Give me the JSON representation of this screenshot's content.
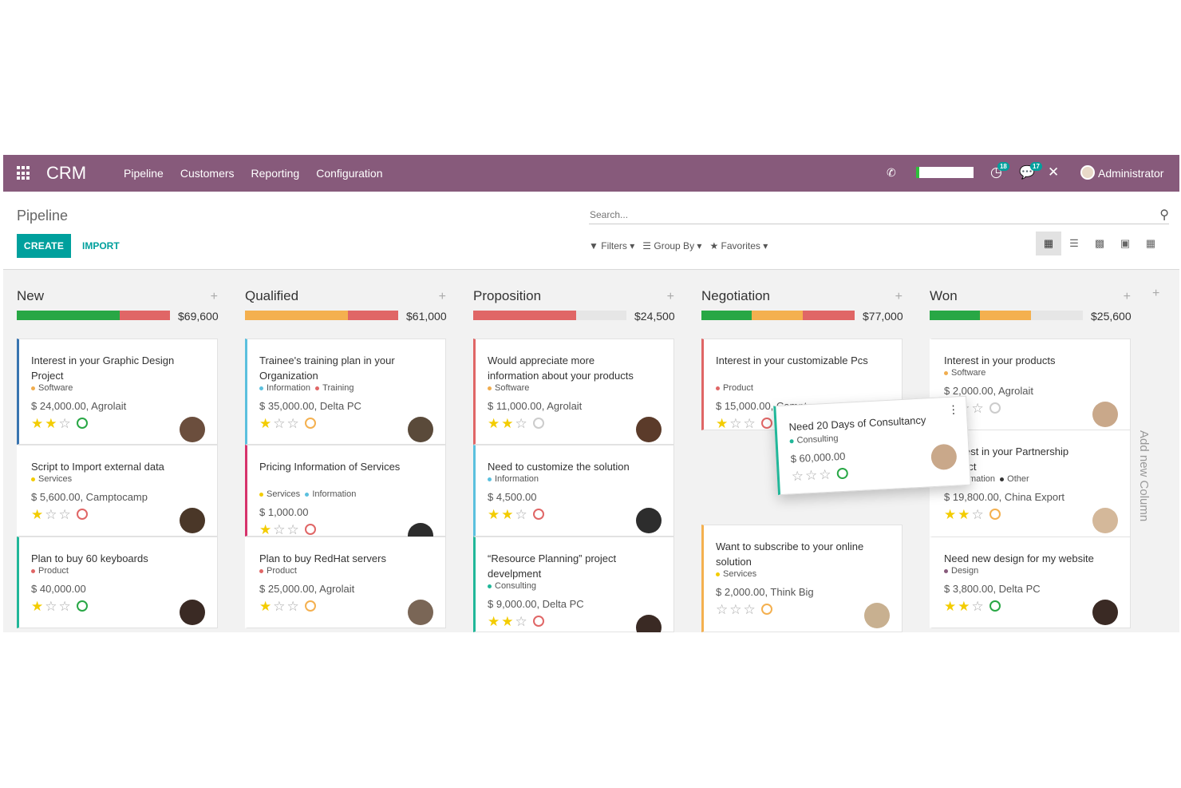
{
  "navbar": {
    "brand": "CRM",
    "menu": [
      "Pipeline",
      "Customers",
      "Reporting",
      "Configuration"
    ],
    "activity_count": "18",
    "message_count": "17",
    "user": "Administrator"
  },
  "control": {
    "breadcrumb": "Pipeline",
    "create_label": "CREATE",
    "import_label": "IMPORT",
    "search_placeholder": "Search...",
    "filters_label": "Filters",
    "group_by_label": "Group By",
    "favorites_label": "Favorites"
  },
  "columns": [
    {
      "title": "New",
      "total": "$69,600",
      "progress": [
        {
          "color": "#28a745",
          "pct": 0.67
        },
        {
          "color": "#e06666",
          "pct": 0.33
        }
      ],
      "cards": [
        {
          "title": "Interest in your Graphic Design Project",
          "tags": [
            {
              "label": "Software",
              "color": "#f0ad4e"
            }
          ],
          "amount": "$ 24,000.00, Agrolait",
          "stars": 2,
          "clock": "#28a745",
          "border": "#3874b0",
          "avatar": "#6b4e3d"
        },
        {
          "title": "Script to Import external data",
          "tags": [
            {
              "label": "Services",
              "color": "#f3cc00"
            }
          ],
          "amount": "$ 5,600.00, Camptocamp",
          "stars": 1,
          "clock": "#e06666",
          "border": "transparent",
          "avatar": "#4a3728"
        },
        {
          "title": "Plan to buy 60 keyboards",
          "tags": [
            {
              "label": "Product",
              "color": "#e06666"
            }
          ],
          "amount": "$ 40,000.00",
          "stars": 1,
          "clock": "#28a745",
          "border": "#21b799",
          "avatar": "#3a2a24"
        }
      ]
    },
    {
      "title": "Qualified",
      "total": "$61,000",
      "progress": [
        {
          "color": "#f4b04f",
          "pct": 0.67
        },
        {
          "color": "#e06666",
          "pct": 0.33
        }
      ],
      "cards": [
        {
          "title": "Trainee's training plan in your Organization",
          "tags": [
            {
              "label": "Information",
              "color": "#5bc0de"
            },
            {
              "label": "Training",
              "color": "#e06666"
            }
          ],
          "amount": "$ 35,000.00, Delta PC",
          "stars": 1,
          "clock": "#f4b04f",
          "border": "#5bc0de",
          "avatar": "#5a4a3a"
        },
        {
          "title": "Pricing Information of Services",
          "tags": [
            {
              "label": "Services",
              "color": "#f3cc00"
            },
            {
              "label": "Information",
              "color": "#5bc0de"
            }
          ],
          "amount": "$ 1,000.00",
          "stars": 1,
          "clock": "#e06666",
          "border": "#d6336c",
          "avatar": "#2d2d2d"
        },
        {
          "title": "Plan to buy RedHat servers",
          "tags": [
            {
              "label": "Product",
              "color": "#e06666"
            }
          ],
          "amount": "$ 25,000.00, Agrolait",
          "stars": 1,
          "clock": "#f4b04f",
          "border": "transparent",
          "avatar": "#7a6656"
        }
      ]
    },
    {
      "title": "Proposition",
      "total": "$24,500",
      "progress": [
        {
          "color": "#e06666",
          "pct": 0.67
        }
      ],
      "cards": [
        {
          "title": "Would appreciate more information about your products",
          "tags": [
            {
              "label": "Software",
              "color": "#f0ad4e"
            }
          ],
          "amount": "$ 11,000.00, Agrolait",
          "stars": 2,
          "clock": "#cccccc",
          "border": "#e06666",
          "avatar": "#5b3b2a"
        },
        {
          "title": "Need to customize the solution",
          "tags": [
            {
              "label": "Information",
              "color": "#5bc0de"
            }
          ],
          "amount": "$ 4,500.00",
          "stars": 2,
          "clock": "#e06666",
          "border": "#5bc0de",
          "avatar": "#2d2d2d"
        },
        {
          "title": "“Resource Planning” project develpment",
          "tags": [
            {
              "label": "Consulting",
              "color": "#21b799"
            }
          ],
          "amount": "$ 9,000.00, Delta PC",
          "stars": 2,
          "clock": "#e06666",
          "border": "#21b799",
          "avatar": "#3a2a24"
        }
      ]
    },
    {
      "title": "Negotiation",
      "total": "$77,000",
      "progress": [
        {
          "color": "#28a745",
          "pct": 0.33
        },
        {
          "color": "#f4b04f",
          "pct": 0.33
        },
        {
          "color": "#e06666",
          "pct": 0.34
        }
      ],
      "cards": [
        {
          "title": "Interest in your customizable Pcs",
          "tags": [
            {
              "label": "Product",
              "color": "#e06666"
            }
          ],
          "amount": "$ 15,000.00, Camptocamp",
          "stars": 1,
          "clock": "#e06666",
          "border": "#e06666",
          "avatar": "#4a3020"
        },
        {
          "title": "Want to subscribe to your online solution",
          "tags": [
            {
              "label": "Services",
              "color": "#f3cc00"
            }
          ],
          "amount": "$ 2,000.00, Think Big",
          "stars": 0,
          "clock": "#f4b04f",
          "border": "#f4b04f",
          "avatar": "#c8b090"
        }
      ]
    },
    {
      "title": "Won",
      "total": "$25,600",
      "progress": [
        {
          "color": "#28a745",
          "pct": 0.33
        },
        {
          "color": "#f4b04f",
          "pct": 0.33
        }
      ],
      "cards": [
        {
          "title": "Interest in your products",
          "tags": [
            {
              "label": "Software",
              "color": "#f0ad4e"
            }
          ],
          "amount": "$ 2,000.00, Agrolait",
          "stars": 1,
          "clock": "#cccccc",
          "border": "transparent",
          "avatar": "#c9a88a"
        },
        {
          "title": "Interest in your Partnership Project",
          "tags": [
            {
              "label": "Information",
              "color": "#5bc0de"
            },
            {
              "label": "Other",
              "color": "#333333"
            }
          ],
          "amount": "$ 19,800.00, China Export",
          "stars": 2,
          "clock": "#f4b04f",
          "border": "transparent",
          "avatar": "#d4b89a"
        },
        {
          "title": "Need new design for my website",
          "tags": [
            {
              "label": "Design",
              "color": "#875a7b"
            }
          ],
          "amount": "$ 3,800.00, Delta PC",
          "stars": 2,
          "clock": "#28a745",
          "border": "transparent",
          "avatar": "#3a2a24"
        }
      ]
    }
  ],
  "dragging_card": {
    "title": "Need 20 Days of Consultancy",
    "tags": [
      {
        "label": "Consulting",
        "color": "#21b799"
      }
    ],
    "amount": "$ 60,000.00",
    "stars": 0,
    "clock": "#28a745",
    "avatar": "#c9a88a"
  },
  "add_column_label": "Add new Column"
}
